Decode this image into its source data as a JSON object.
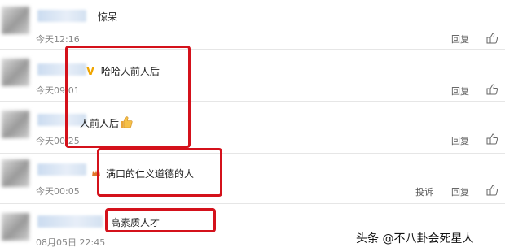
{
  "comments": [
    {
      "text": "惊呆",
      "time": "今天12:16",
      "actions": [
        "回复"
      ]
    },
    {
      "text": "哈哈人前人后",
      "badge": "V",
      "time": "今天09:01",
      "actions": [
        "回复"
      ]
    },
    {
      "text": "人前人后",
      "emoji": "thumbs-up-emoji",
      "time": "今天00:25",
      "actions": [
        "回复"
      ]
    },
    {
      "text": "满口的仁义道德的人",
      "time": "今天00:05",
      "actions": [
        "投诉",
        "回复"
      ]
    },
    {
      "text": "高素质人才",
      "time": "08月05日 22:45",
      "actions": []
    }
  ],
  "watermark": "头条 @不八卦会死星人",
  "colors": {
    "highlight_box": "#d4111b",
    "time_text": "#888888",
    "badge": "#f0a500"
  }
}
